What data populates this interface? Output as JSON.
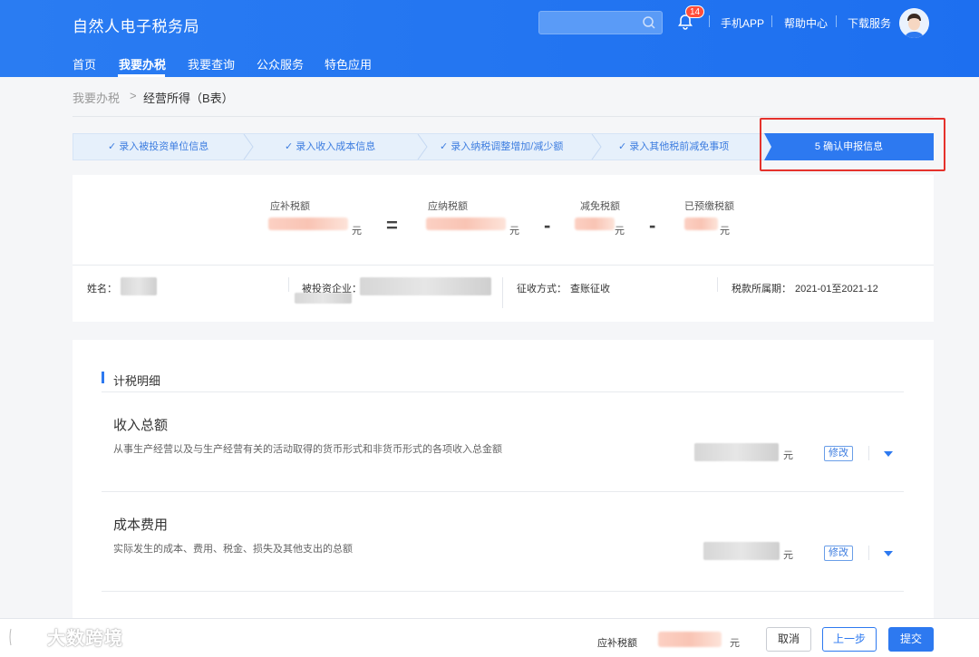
{
  "header": {
    "brand": "自然人电子税务局",
    "notification_count": "14",
    "links": [
      "手机APP",
      "帮助中心",
      "下载服务"
    ]
  },
  "nav": {
    "items": [
      "首页",
      "我要办税",
      "我要查询",
      "公众服务",
      "特色应用"
    ]
  },
  "breadcrumb": {
    "parent": "我要办税",
    "separator": ">",
    "current": "经营所得（B表）"
  },
  "steps": {
    "items": [
      "✓ 录入被投资单位信息",
      "✓ 录入收入成本信息",
      "✓ 录入纳税调整增加/减少额",
      "✓ 录入其他税前减免事项"
    ],
    "active": "5   确认申报信息"
  },
  "summary": {
    "labels": [
      "应补税额",
      "应纳税额",
      "减免税额",
      "已预缴税额"
    ],
    "unit": "元",
    "ops": [
      "=",
      "-",
      "-"
    ]
  },
  "info": {
    "name_label": "姓名：",
    "company_label": "被投资企业：",
    "method_label": "征收方式：",
    "method_value": "查账征收",
    "period_label": "税款所属期：",
    "period_value": "2021-01至2021-12"
  },
  "detail": {
    "section_title": "计税明细",
    "items": [
      {
        "title": "收入总额",
        "desc": "从事生产经营以及与生产经营有关的活动取得的货币形式和非货币形式的各项收入总金额",
        "unit": "元",
        "edit": "修改"
      },
      {
        "title": "成本费用",
        "desc": "实际发生的成本、费用、税金、损失及其他支出的总额",
        "unit": "元",
        "edit": "修改"
      }
    ]
  },
  "footer": {
    "label": "应补税额",
    "unit": "元",
    "cancel": "取消",
    "prev": "上一步",
    "submit": "提交"
  },
  "watermark": "大数跨境"
}
